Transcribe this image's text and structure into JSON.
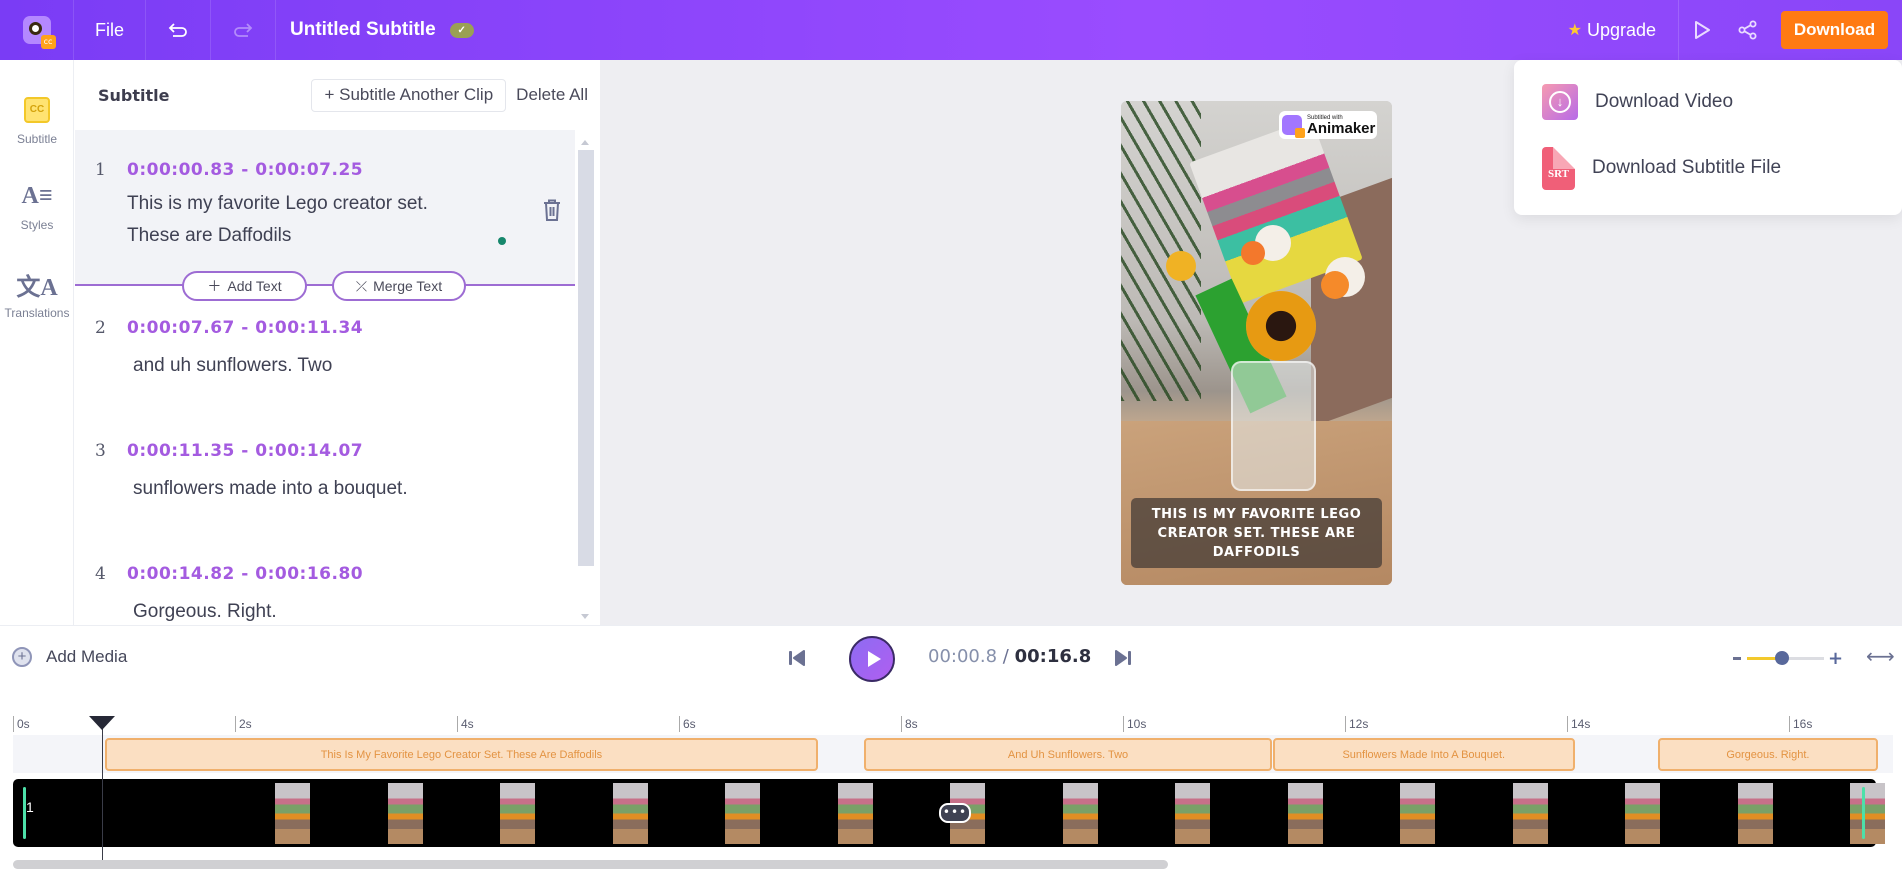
{
  "app": {
    "title": "Untitled Subtitle",
    "file_menu": "File",
    "upgrade_label": "Upgrade",
    "download_label": "Download",
    "accent": "#9a4cff",
    "download_color": "#ff7a12"
  },
  "rail": {
    "items": [
      {
        "label": "Subtitle",
        "icon": "cc-icon",
        "active": true
      },
      {
        "label": "Styles",
        "icon": "text-style-icon"
      },
      {
        "label": "Translations",
        "icon": "translate-icon"
      }
    ]
  },
  "panel": {
    "title": "Subtitle",
    "add_clip_label": "+ Subtitle Another Clip",
    "delete_all_label": "Delete All",
    "add_text_label": "Add Text",
    "merge_text_label": "Merge Text",
    "subtitles": [
      {
        "num": "1",
        "time": "0:00:00.83 - 0:00:07.25",
        "lines": [
          "This is my favorite Lego creator set.",
          "These are Daffodils"
        ]
      },
      {
        "num": "2",
        "time": "0:00:07.67 - 0:00:11.34",
        "lines": [
          "and uh sunflowers. Two"
        ]
      },
      {
        "num": "3",
        "time": "0:00:11.35 - 0:00:14.07",
        "lines": [
          "sunflowers made into a bouquet."
        ]
      },
      {
        "num": "4",
        "time": "0:00:14.82 - 0:00:16.80",
        "lines": [
          "Gorgeous. Right."
        ]
      }
    ]
  },
  "preview": {
    "watermark_small": "Subtitled with",
    "watermark_big": "Animaker",
    "caption": "This is my favorite Lego creator set. These are Daffodils"
  },
  "download_menu": {
    "items": [
      {
        "label": "Download Video",
        "icon": "download-video-icon"
      },
      {
        "label": "Download Subtitle File",
        "icon": "srt-file-icon",
        "icon_text": "SRT"
      }
    ]
  },
  "controls": {
    "add_media_label": "Add Media",
    "current_time": "00:00.8",
    "separator": "/",
    "total_time": "00:16.8",
    "zoom_level": 0.45
  },
  "timeline": {
    "duration_s": 16.8,
    "playhead_s": 0.8,
    "ticks": [
      "0s",
      "2s",
      "4s",
      "6s",
      "8s",
      "10s",
      "12s",
      "14s",
      "16s"
    ],
    "segments": [
      {
        "label": "This Is My Favorite Lego Creator Set. These Are Daffodils",
        "start": 0.83,
        "end": 7.25
      },
      {
        "label": "And Uh Sunflowers. Two",
        "start": 7.67,
        "end": 11.34
      },
      {
        "label": "Sunflowers Made Into A Bouquet.",
        "start": 11.35,
        "end": 14.07
      },
      {
        "label": "Gorgeous. Right.",
        "start": 14.82,
        "end": 16.8
      }
    ],
    "track_label": "1"
  }
}
